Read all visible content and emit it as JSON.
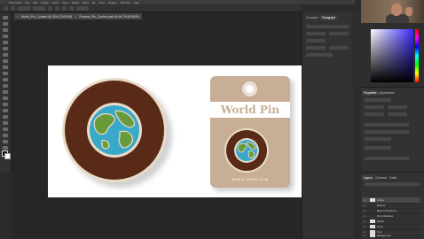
{
  "menu": {
    "items": [
      "Photoshop",
      "File",
      "Edit",
      "Image",
      "Layer",
      "Type",
      "Select",
      "Filter",
      "3D",
      "View",
      "Plugins",
      "Window",
      "Help"
    ]
  },
  "document": {
    "tab_title": "World_Pin_Content @ 33% (CMYK/8)",
    "tab_title_2": "Preview_Pin_Content.psd @ 66.7% (RGB/8)"
  },
  "artwork": {
    "card_title": "World Pin",
    "card_caption": "WORLD TRAVEL CLUB"
  },
  "panels": {
    "tabs": [
      "Character",
      "Paragraph"
    ],
    "properties_tabs": [
      "Properties",
      "Adjustments"
    ],
    "layers_tabs": [
      "Layers",
      "Channels",
      "Paths"
    ],
    "layers": [
      "Circle",
      "Effects",
      "Bevel & Emboss",
      "Drop Shadow",
      "World",
      "Card",
      "Text",
      "Background"
    ]
  },
  "colors": {
    "brown": "#5a2a18",
    "cream": "#e8dcc8",
    "tan": "#c7ae95",
    "ocean": "#3aa8c8",
    "land": "#6a9a3a"
  }
}
